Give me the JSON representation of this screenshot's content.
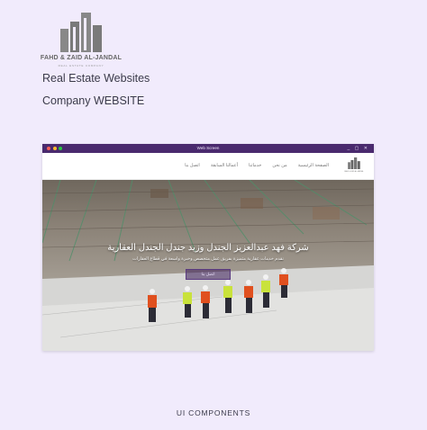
{
  "brand": {
    "name": "FAHD & ZAID AL-JANDAL",
    "tagline": "REAL ESTATE COMPANY"
  },
  "headings": {
    "line1": "Real Estate Websites",
    "line2": "Company WEBSITE"
  },
  "window": {
    "title": "Web Screen",
    "controls": "_ ▢ ✕",
    "dot_colors": [
      "#ff5f57",
      "#febc2e",
      "#28c840"
    ],
    "nav_logo_text": "FAHD & ZAID AL-JANDAL",
    "nav": [
      "الصفحة الرئيسية",
      "من نحن",
      "خدماتنا",
      "أعمالنا السابقة",
      "اتصل بنا"
    ],
    "hero_title": "شركة فهد عبدالعزيز الجندل وزيد جندل الجندل العقارية",
    "hero_subtitle": "نقدم خدمات عقارية متميزة بفريق عمل متخصص وخبرة واسعة في قطاع العقارات",
    "hero_button": "اتصل بنا"
  },
  "footer": {
    "label": "UI COMPONENTS"
  }
}
